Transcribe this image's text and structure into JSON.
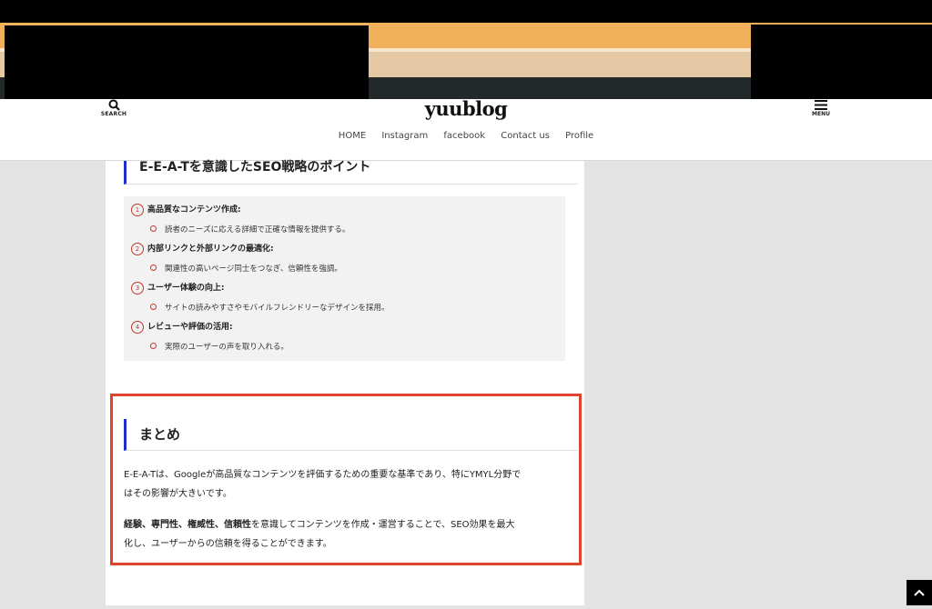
{
  "header": {
    "logo": "yuublog",
    "search_label": "SEARCH",
    "menu_label": "MENU",
    "nav": [
      "HOME",
      "Instagram",
      "facebook",
      "Contact us",
      "Profile"
    ]
  },
  "section1": {
    "heading": "E-E-A-Tを意識したSEO戦略のポイント",
    "items": [
      {
        "num": "1",
        "title": "高品質なコンテンツ作成:",
        "sub": "読者のニーズに応える詳細で正確な情報を提供する。"
      },
      {
        "num": "2",
        "title": "内部リンクと外部リンクの最適化:",
        "sub": "関連性の高いページ同士をつなぎ、信頼性を強調。"
      },
      {
        "num": "3",
        "title": "ユーザー体験の向上:",
        "sub": "サイトの読みやすさやモバイルフレンドリーなデザインを採用。"
      },
      {
        "num": "4",
        "title": "レビューや評価の活用:",
        "sub": "実際のユーザーの声を取り入れる。"
      }
    ]
  },
  "summary": {
    "heading": "まとめ",
    "p1_line1": "E-E-A-Tは、Googleが高品質なコンテンツを評価するための重要な基準であり、特にYMYL分野で",
    "p1_line2": "はその影響が大きいです。",
    "p2_bold": "経験、専門性、権威性、信頼性",
    "p2_line1_rest": "を意識してコンテンツを作成・運営することで、SEO効果を最大",
    "p2_line2": "化し、ユーザーからの信頼を得ることができます。"
  },
  "colors": {
    "accent_blue": "#1f2fd0",
    "highlight_red": "#e0442d",
    "number_red": "#c0392b"
  },
  "icons": {
    "search": "search-icon",
    "menu": "hamburger-menu-icon",
    "scroll_top": "chevron-up-icon"
  }
}
